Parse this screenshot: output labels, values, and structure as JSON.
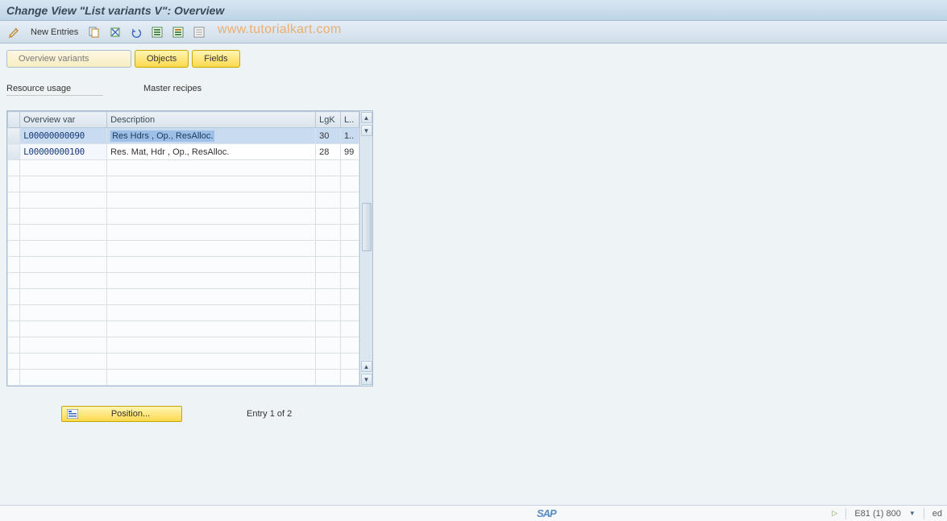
{
  "title": "Change View \"List variants                  V\": Overview",
  "toolbar": {
    "new_entries": "New Entries"
  },
  "watermark": "www.tutorialkart.com",
  "tabs": {
    "overview_variants": "Overview variants",
    "objects": "Objects",
    "fields": "Fields"
  },
  "labels": {
    "resource_usage": "Resource usage",
    "master_recipes": "Master recipes"
  },
  "table": {
    "headers": {
      "overview_var": "Overview var",
      "description": "Description",
      "lgk": "LgK",
      "lext": "L.."
    },
    "rows": [
      {
        "ovar": "L00000000090",
        "desc": "Res   Hdrs , Op., ResAlloc.",
        "lgk": "30",
        "lext": "1..",
        "selected": true
      },
      {
        "ovar": "L00000000100",
        "desc": "Res.  Mat, Hdr , Op., ResAlloc.",
        "lgk": "28",
        "lext": "99",
        "selected": false
      }
    ],
    "empty_rows": 14
  },
  "footer": {
    "position_btn": "Position...",
    "entry_text": "Entry 1 of 2"
  },
  "status": {
    "sap": "SAP",
    "system": "E81 (1) 800",
    "tail": "ed"
  }
}
